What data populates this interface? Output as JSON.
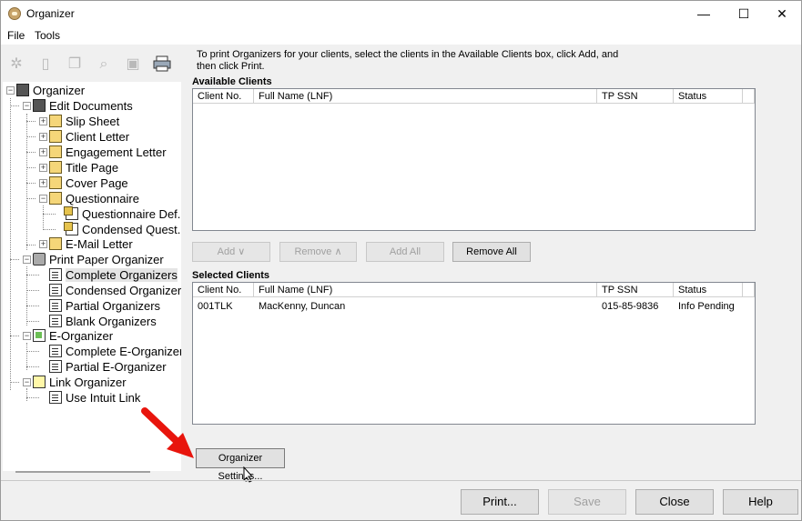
{
  "window": {
    "title": "Organizer",
    "controls": {
      "minimize": "—",
      "maximize": "☐",
      "close": "✕"
    }
  },
  "menu": {
    "items": [
      "File",
      "Tools"
    ]
  },
  "instructions": "To print Organizers for your clients, select the clients in the Available Clients box, click Add, and then click Print.",
  "tree": {
    "root": "Organizer",
    "edit_documents": "Edit Documents",
    "slip_sheet": "Slip Sheet",
    "client_letter": "Client Letter",
    "engagement_letter": "Engagement Letter",
    "title_page": "Title Page",
    "cover_page": "Cover Page",
    "questionnaire": "Questionnaire",
    "questionnaire_def": "Questionnaire Def.",
    "condensed_quest": "Condensed Quest.",
    "email_letter": "E-Mail Letter",
    "print_paper_organizer": "Print Paper Organizer",
    "complete_organizers": "Complete Organizers",
    "condensed_organizers": "Condensed Organizers",
    "partial_organizers": "Partial Organizers",
    "blank_organizers": "Blank Organizers",
    "e_organizer": "E-Organizer",
    "complete_e_organizer": "Complete E-Organizer",
    "partial_e_organizer": "Partial E-Organizer",
    "link_organizer": "Link Organizer",
    "use_intuit_link": "Use Intuit Link"
  },
  "available_clients": {
    "title": "Available Clients",
    "columns": [
      "Client No.",
      "Full Name (LNF)",
      "TP SSN",
      "Status"
    ],
    "rows": []
  },
  "selected_clients": {
    "title": "Selected Clients",
    "columns": [
      "Client No.",
      "Full Name (LNF)",
      "TP SSN",
      "Status"
    ],
    "rows": [
      {
        "client_no": "001TLK",
        "name": "MacKenny, Duncan",
        "ssn": "015-85-9836",
        "status": "Info Pending"
      }
    ]
  },
  "buttons": {
    "add": "Add ∨",
    "remove": "Remove ∧",
    "add_all": "Add All",
    "remove_all": "Remove All",
    "organizer_settings": "Organizer Settings...",
    "print": "Print...",
    "save": "Save",
    "close": "Close",
    "help": "Help"
  },
  "colors": {
    "annotation_arrow": "#e8150d"
  }
}
